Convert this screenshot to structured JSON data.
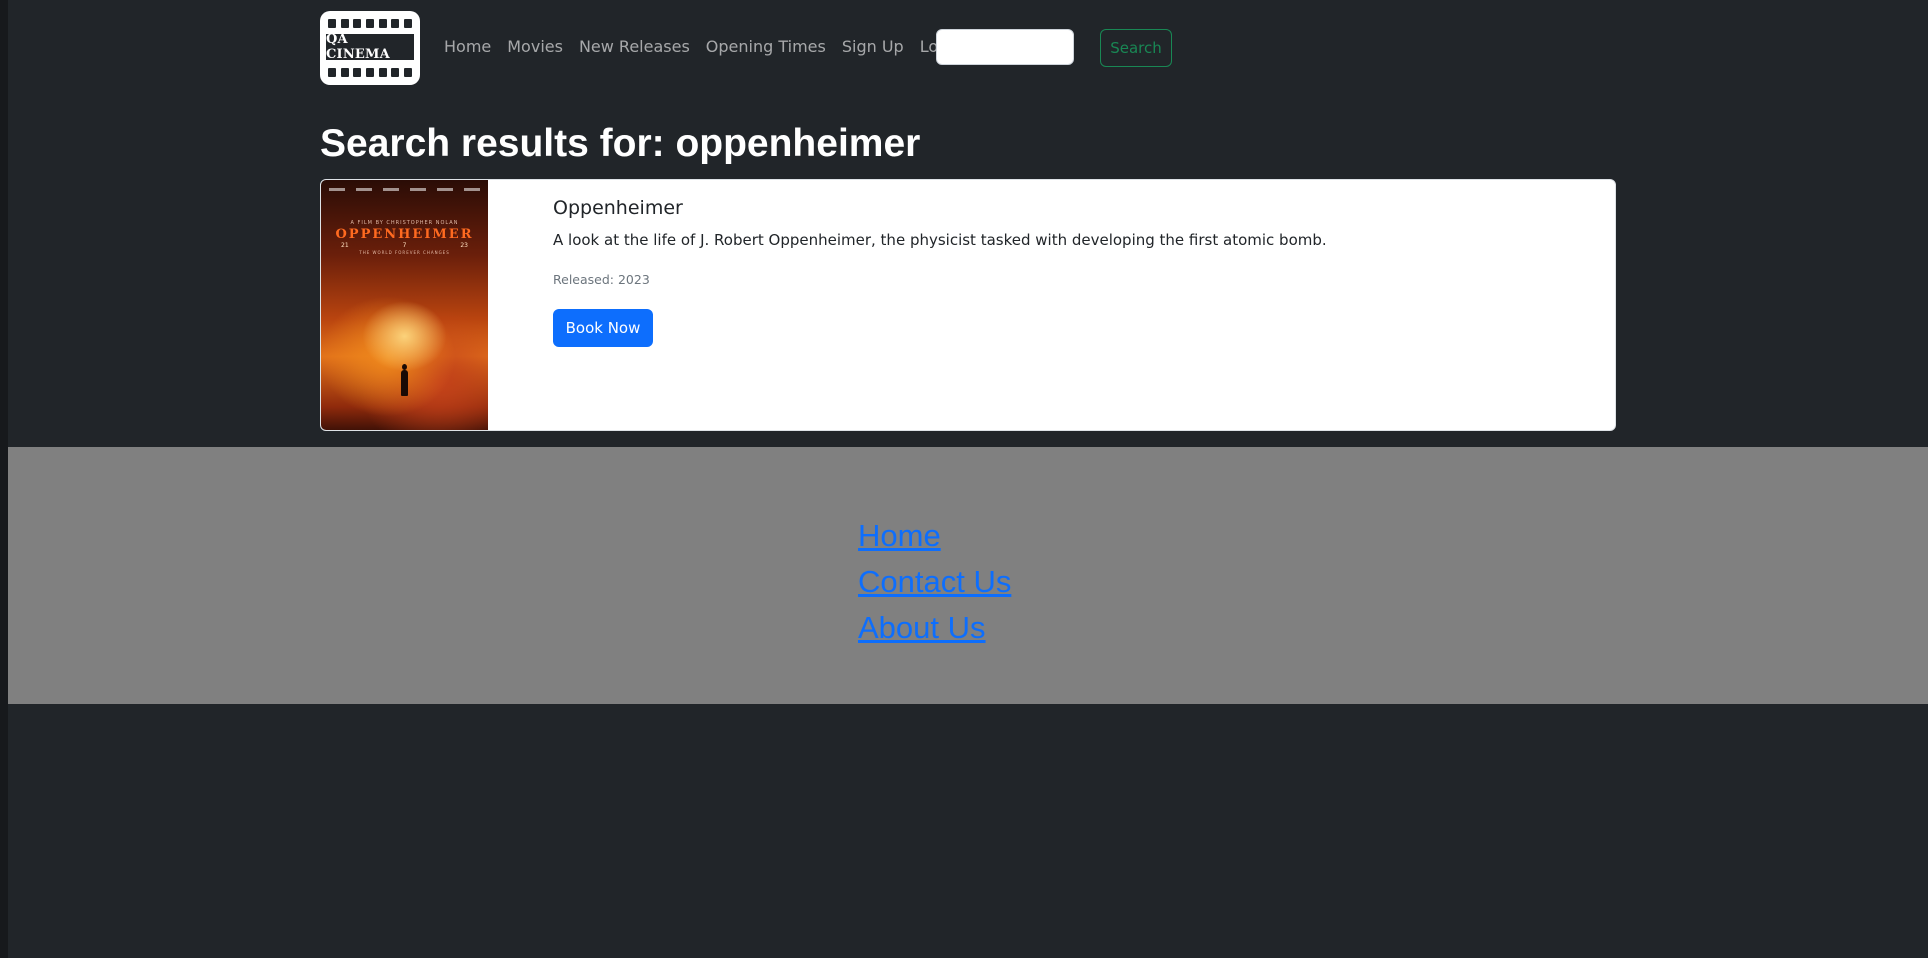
{
  "navbar": {
    "logo_text": "QA CINEMA",
    "links": [
      "Home",
      "Movies",
      "New Releases",
      "Opening Times",
      "Sign Up",
      "Log In"
    ],
    "search": {
      "value": "",
      "button_label": "Search"
    }
  },
  "main": {
    "heading": "Search results for: oppenheimer",
    "results": [
      {
        "title": "Oppenheimer",
        "description": "A look at the life of J. Robert Oppenheimer, the physicist tasked with developing the first atomic bomb.",
        "released": "Released: 2023",
        "button_label": "Book Now",
        "poster": {
          "byline": "A FILM BY CHRISTOPHER NOLAN",
          "title": "OPPENHEIMER",
          "date_left": "21",
          "date_mid": "7",
          "date_right": "23",
          "tagline": "THE WORLD FOREVER CHANGES"
        }
      }
    ]
  },
  "footer": {
    "links": [
      "Home",
      "Contact Us",
      "About Us"
    ]
  },
  "colors": {
    "page_bg": "#212529",
    "footer_bg": "#808080",
    "primary": "#0d6efd",
    "success": "#198754"
  }
}
